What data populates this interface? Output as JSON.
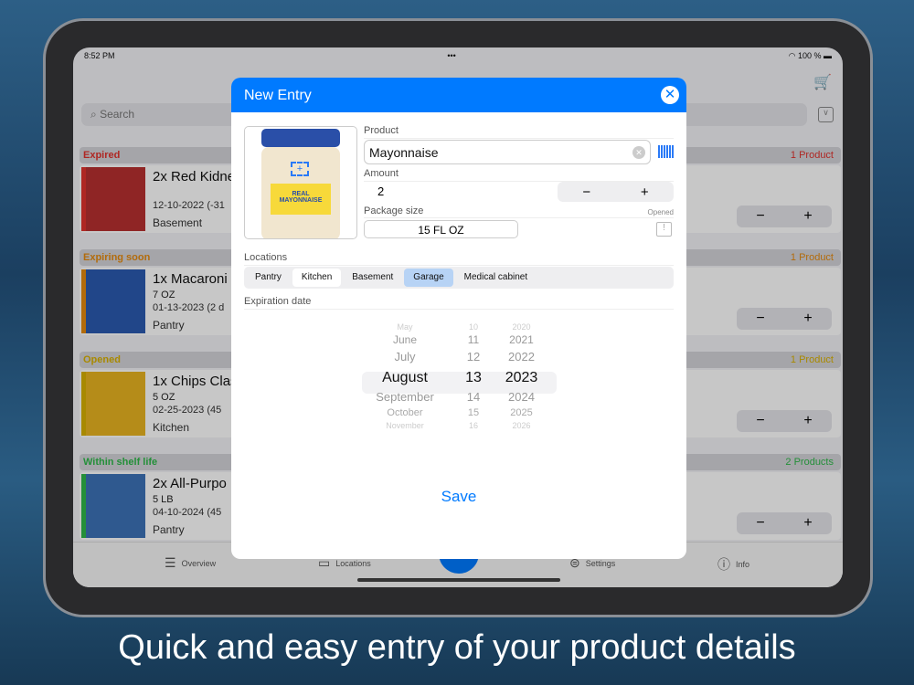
{
  "status": {
    "time": "8:52 PM",
    "battery": "100 %"
  },
  "search": {
    "placeholder": "Search"
  },
  "sections": [
    {
      "title": "Expired",
      "count": "1 Product",
      "color": "#e0332e",
      "item": {
        "title": "2x Red Kidne",
        "size": "",
        "date": "12-10-2022 (-31",
        "location": "Basement"
      }
    },
    {
      "title": "Expiring soon",
      "count": "1 Product",
      "color": "#e58a0f",
      "item": {
        "title": "1x Macaroni",
        "size": "7 OZ",
        "date": "01-13-2023 (2 d",
        "location": "Pantry"
      }
    },
    {
      "title": "Opened",
      "count": "1 Product",
      "color": "#d8b000",
      "item": {
        "title": "1x Chips Clas",
        "size": "5 OZ",
        "date": "02-25-2023 (45",
        "location": "Kitchen"
      }
    },
    {
      "title": "Within shelf life",
      "count": "2 Products",
      "color": "#2fb84a",
      "item": {
        "title": "2x All-Purpo",
        "size": "5 LB",
        "date": "04-10-2024 (45",
        "location": "Pantry"
      }
    }
  ],
  "tabs": [
    {
      "label": "Overview",
      "icon": "list-icon"
    },
    {
      "label": "Locations",
      "icon": "tray-icon"
    },
    {
      "label": "Settings",
      "icon": "toggle-icon"
    },
    {
      "label": "Info",
      "icon": "info-icon"
    }
  ],
  "modal": {
    "title": "New Entry",
    "product_label": "Product",
    "product_value": "Mayonnaise",
    "amount_label": "Amount",
    "amount_value": "2",
    "package_label": "Package size",
    "package_value": "15 FL OZ",
    "opened_label": "Opened",
    "locations_label": "Locations",
    "locations": [
      "Pantry",
      "Kitchen",
      "Basement",
      "Garage",
      "Medical cabinet"
    ],
    "selected_location": "Garage",
    "expiration_label": "Expiration date",
    "picker": [
      [
        "May",
        "10",
        "2020"
      ],
      [
        "June",
        "11",
        "2021"
      ],
      [
        "July",
        "12",
        "2022"
      ],
      [
        "August",
        "13",
        "2023"
      ],
      [
        "September",
        "14",
        "2024"
      ],
      [
        "October",
        "15",
        "2025"
      ],
      [
        "November",
        "16",
        "2026"
      ]
    ],
    "save_label": "Save",
    "image_text": "REAL MAYONNAISE"
  },
  "caption": "Quick and easy entry of your product details",
  "accent": "#007aff"
}
